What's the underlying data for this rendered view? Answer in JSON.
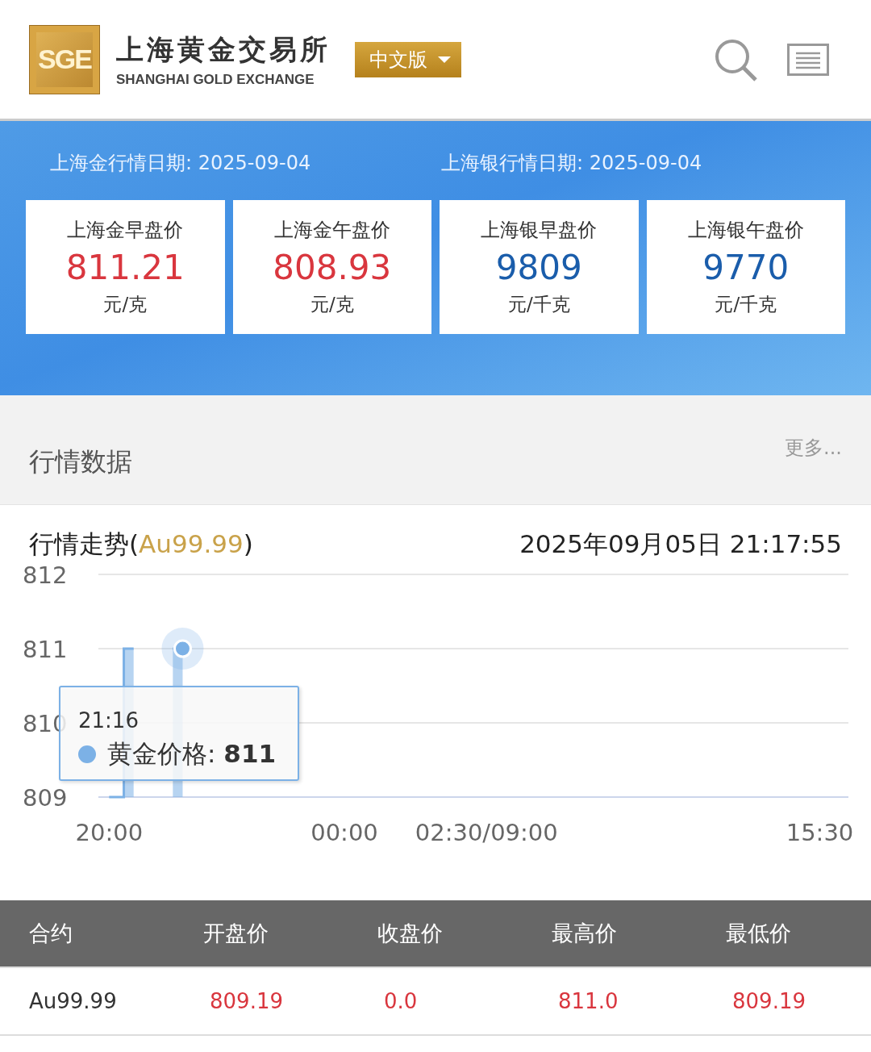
{
  "header": {
    "logo_mark": "SGE",
    "logo_cn": "上海黄金交易所",
    "logo_en": "SHANGHAI GOLD EXCHANGE",
    "language": "中文版"
  },
  "banner": {
    "dates": [
      "上海金行情日期: 2025-09-04",
      "上海银行情日期: 2025-09-04"
    ],
    "cards": [
      {
        "title": "上海金早盘价",
        "value": "811.21",
        "unit": "元/克",
        "color": "#d9363e"
      },
      {
        "title": "上海金午盘价",
        "value": "808.93",
        "unit": "元/克",
        "color": "#d9363e"
      },
      {
        "title": "上海银早盘价",
        "value": "9809",
        "unit": "元/千克",
        "color": "#1a5dab"
      },
      {
        "title": "上海银午盘价",
        "value": "9770",
        "unit": "元/千克",
        "color": "#1a5dab"
      }
    ]
  },
  "market": {
    "title": "行情数据",
    "more": "更多..."
  },
  "trend": {
    "title": "行情走势(",
    "symbol": "Au99.99",
    "title_end": ")",
    "timestamp": "2025年09月05日 21:17:55",
    "chart_data": {
      "type": "area",
      "categories": [
        "20:00",
        null,
        null,
        null,
        null,
        null,
        null,
        null,
        null,
        null,
        null,
        null,
        null,
        null,
        null,
        null,
        null,
        null,
        null,
        null,
        null,
        null,
        null,
        null,
        null,
        null,
        null,
        null,
        null,
        null,
        null,
        null,
        null,
        null,
        null,
        null,
        null,
        null,
        null,
        null,
        null,
        null,
        null,
        null,
        null,
        null,
        null,
        null,
        "00:00",
        null,
        null,
        null,
        null,
        null,
        null,
        null,
        null,
        null,
        null,
        null,
        null,
        null,
        null,
        null,
        null,
        null,
        null,
        null,
        null,
        null,
        null,
        null,
        null,
        null,
        null,
        null,
        null,
        "02:30/09:00",
        null,
        null,
        null,
        null,
        null,
        null,
        null,
        null,
        null,
        null,
        null,
        null,
        null,
        null,
        null,
        null,
        null,
        null,
        null,
        null,
        null,
        null,
        null,
        null,
        null,
        null,
        null,
        null,
        null,
        null,
        null,
        null,
        null,
        null,
        null,
        null,
        null,
        null,
        null,
        null,
        null,
        null,
        null,
        null,
        null,
        null,
        null,
        null,
        null,
        null,
        null,
        null,
        null,
        null,
        null,
        null,
        null,
        null,
        null,
        null,
        null,
        null,
        null,
        null,
        null,
        null,
        null,
        "15:30"
      ],
      "series": [
        {
          "name": "黄金价格",
          "color": "#7cb1e6",
          "values": [
            809,
            809,
            809,
            811,
            811,
            811,
            null,
            null,
            null,
            null,
            null,
            null,
            null,
            811,
            811,
            811,
            null,
            null,
            null,
            null,
            null,
            null,
            null,
            null,
            null,
            null,
            null,
            null,
            null,
            null,
            null,
            null,
            null,
            null,
            null,
            null,
            null,
            null,
            null,
            null,
            null,
            null,
            null,
            null,
            null,
            null,
            null,
            null,
            null,
            null,
            null,
            null,
            null,
            null,
            null,
            null,
            null,
            null,
            null,
            null,
            null,
            null,
            null,
            null,
            null,
            null,
            null,
            null,
            null,
            null,
            null,
            null,
            null,
            null,
            null,
            null,
            null,
            null,
            null,
            null,
            null,
            null,
            null,
            null,
            null,
            null,
            null,
            null,
            null,
            null,
            null,
            null,
            null,
            null,
            null,
            null,
            null,
            null,
            null,
            null,
            null,
            null,
            null,
            null,
            null,
            null,
            null,
            null,
            null,
            null,
            null,
            null,
            null,
            null,
            null,
            null,
            null,
            null,
            null,
            null,
            null,
            null,
            null,
            null,
            null,
            null,
            null,
            null,
            null,
            null,
            null,
            null,
            null,
            null,
            null,
            null,
            null,
            null,
            null,
            null,
            null,
            null,
            null,
            null,
            null,
            null
          ]
        }
      ],
      "ylim": [
        809,
        812
      ],
      "yticks": [
        809,
        810,
        811,
        812
      ]
    },
    "tooltip": {
      "time": "21:16",
      "separator": ": ",
      "value": "811"
    }
  },
  "table": {
    "columns": [
      "合约",
      "开盘价",
      "收盘价",
      "最高价",
      "最低价"
    ],
    "rows": [
      {
        "cells": [
          "Au99.99",
          "809.19",
          "0.0",
          "811.0",
          "809.19"
        ]
      }
    ]
  }
}
